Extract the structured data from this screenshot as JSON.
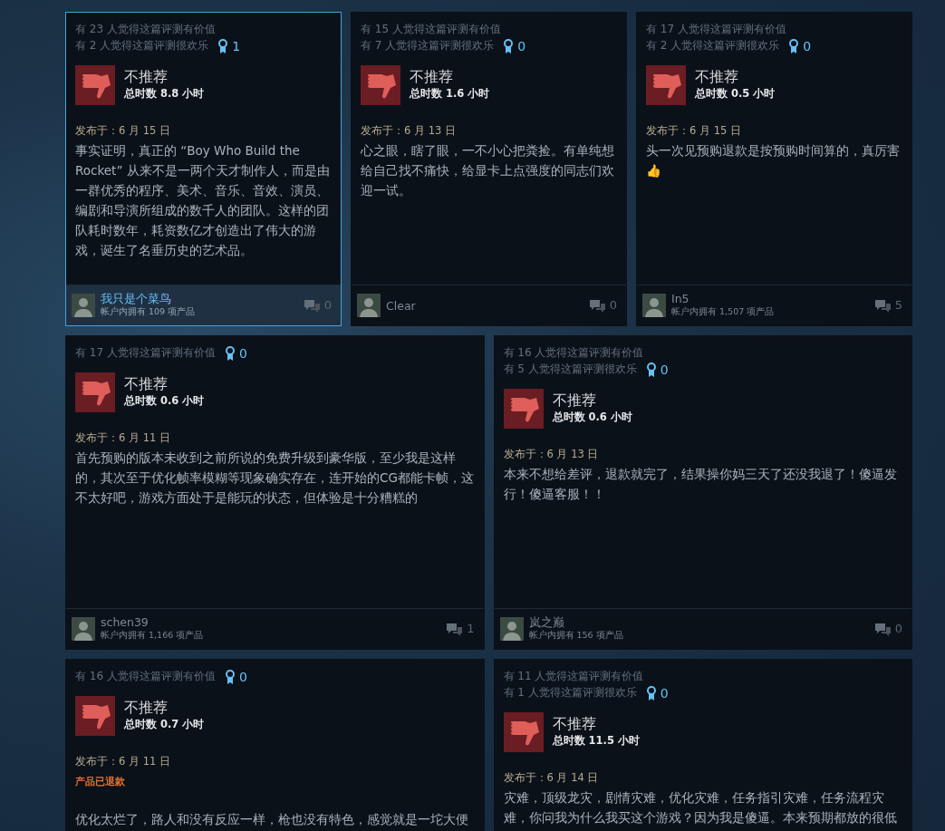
{
  "reviews": [
    {
      "helpful": "有 23 人觉得这篇评测有价值",
      "funny": "有 2 人觉得这篇评测很欢乐",
      "awards": "1",
      "verdict": "不推荐",
      "recommended": false,
      "hours": "总时数 8.8 小时",
      "posted": "发布于：6 月 15 日",
      "text": "事实证明，真正的 “Boy Who Build the Rocket” 从来不是一两个天才制作人，而是由一群优秀的程序、美术、音乐、音效、演员、编剧和导演所组成的数千人的团队。这样的团队耗时数年，耗资数亿才创造出了伟大的游戏，诞生了名垂历史的艺术品。",
      "highlighted": true,
      "author": {
        "name": "我只是个菜鸟",
        "products": "帐户内拥有 109 项产品"
      },
      "comments": "0"
    },
    {
      "helpful": "有 15 人觉得这篇评测有价值",
      "funny": "有 7 人觉得这篇评测很欢乐",
      "awards": "0",
      "verdict": "不推荐",
      "recommended": false,
      "hours": "总时数 1.6 小时",
      "posted": "发布于：6 月 13 日",
      "text": "心之眼，瞎了眼，一不小心把粪捡。有单纯想给自己找不痛快，给显卡上点强度的同志们欢迎一试。",
      "highlighted": false,
      "author": {
        "name": "Clear"
      },
      "comments": "0"
    },
    {
      "helpful": "有 17 人觉得这篇评测有价值",
      "funny": "有 2 人觉得这篇评测很欢乐",
      "awards": "0",
      "verdict": "不推荐",
      "recommended": false,
      "hours": "总时数 0.5 小时",
      "posted": "发布于：6 月 15 日",
      "text": "头一次见预购退款是按预购时间算的，真厉害👍",
      "highlighted": false,
      "author": {
        "name": "In5",
        "products": "帐户内拥有 1,507 项产品"
      },
      "comments": "5"
    },
    {
      "helpful": "有 17 人觉得这篇评测有价值",
      "awards": "0",
      "verdict": "不推荐",
      "recommended": false,
      "hours": "总时数 0.6 小时",
      "posted": "发布于：6 月 11 日",
      "text": "首先预购的版本未收到之前所说的免费升级到豪华版，至少我是这样的，其次至于优化帧率模糊等现象确实存在，连开始的CG都能卡帧，这不太好吧，游戏方面处于是能玩的状态，但体验是十分糟糕的",
      "highlighted": false,
      "author": {
        "name": "schen39",
        "products": "帐户内拥有 1,166 项产品"
      },
      "comments": "1"
    },
    {
      "helpful": "有 16 人觉得这篇评测有价值",
      "funny": "有 5 人觉得这篇评测很欢乐",
      "awards": "0",
      "verdict": "不推荐",
      "recommended": false,
      "hours": "总时数 0.6 小时",
      "posted": "发布于：6 月 13 日",
      "text": "本来不想给差评，退款就完了，结果操你妈三天了还没我退了！傻逼发行！傻逼客服！！",
      "highlighted": false,
      "author": {
        "name": "岚之巅",
        "products": "帐户内拥有 156 项产品"
      },
      "comments": "0"
    },
    {
      "helpful": "有 16 人觉得这篇评测有价值",
      "awards": "0",
      "verdict": "不推荐",
      "recommended": false,
      "hours": "总时数 0.7 小时",
      "posted": "发布于：6 月 11 日",
      "refunded": "产品已退款",
      "text": "优化太烂了，路人和没有反应一样，枪也没有特色，感觉就是一坨大便",
      "highlighted": false
    },
    {
      "helpful": "有 11 人觉得这篇评测有价值",
      "funny": "有 1 人觉得这篇评测很欢乐",
      "awards": "0",
      "verdict": "不推荐",
      "recommended": false,
      "hours": "总时数 11.5 小时",
      "posted": "发布于：6 月 14 日",
      "text": "灾难，顶级龙灾，剧情灾难，优化灾难，任务指引灾难，任务流程灾难，你问我为什么我买这个游戏？因为我是傻逼。本来预期都放的很低",
      "highlighted": false
    }
  ]
}
